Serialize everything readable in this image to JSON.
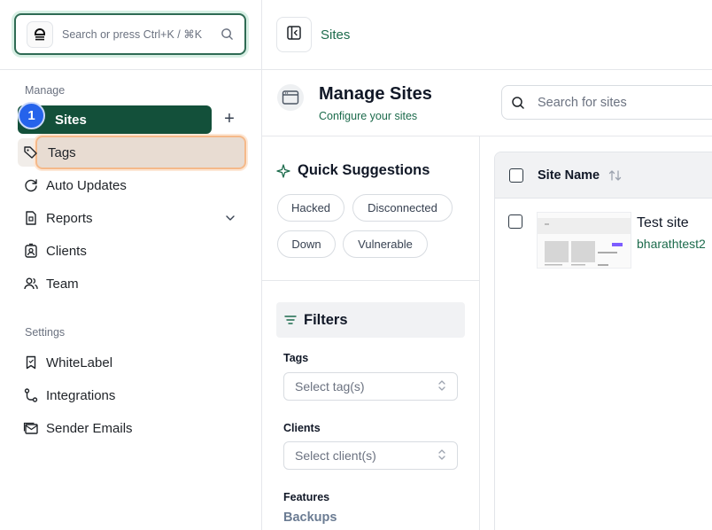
{
  "sidebar": {
    "search_placeholder": "Search or press Ctrl+K / ⌘K",
    "manage_label": "Manage",
    "settings_label": "Settings",
    "step_badge": "1",
    "add_label": "+",
    "manage_items": [
      {
        "label": "Sites",
        "icon": "sites-icon",
        "active": true
      },
      {
        "label": "Tags",
        "icon": "tag-icon",
        "highlighted": true
      },
      {
        "label": "Auto Updates",
        "icon": "refresh-icon"
      },
      {
        "label": "Reports",
        "icon": "report-icon",
        "expandable": true
      },
      {
        "label": "Clients",
        "icon": "client-badge-icon"
      },
      {
        "label": "Team",
        "icon": "team-icon"
      }
    ],
    "settings_items": [
      {
        "label": "WhiteLabel",
        "icon": "bookmark-icon"
      },
      {
        "label": "Integrations",
        "icon": "integrations-icon"
      },
      {
        "label": "Sender Emails",
        "icon": "email-icon"
      }
    ]
  },
  "topbar": {
    "breadcrumb": "Sites"
  },
  "page": {
    "title": "Manage Sites",
    "subtitle": "Configure your sites",
    "search_placeholder": "Search for sites"
  },
  "quick_suggestions": {
    "title": "Quick Suggestions",
    "chips": [
      "Hacked",
      "Disconnected",
      "Down",
      "Vulnerable"
    ]
  },
  "filters": {
    "title": "Filters",
    "tags_label": "Tags",
    "tags_placeholder": "Select tag(s)",
    "clients_label": "Clients",
    "clients_placeholder": "Select client(s)",
    "features_label": "Features",
    "features_first": "Backups"
  },
  "table": {
    "column_site_name": "Site Name",
    "rows": [
      {
        "name": "Test site",
        "url": "bharathtest2"
      }
    ]
  },
  "colors": {
    "brand_green": "#13503a",
    "link_green": "#1c6b4c",
    "badge_blue": "#2563eb",
    "highlight_orange": "#f5b98a"
  }
}
